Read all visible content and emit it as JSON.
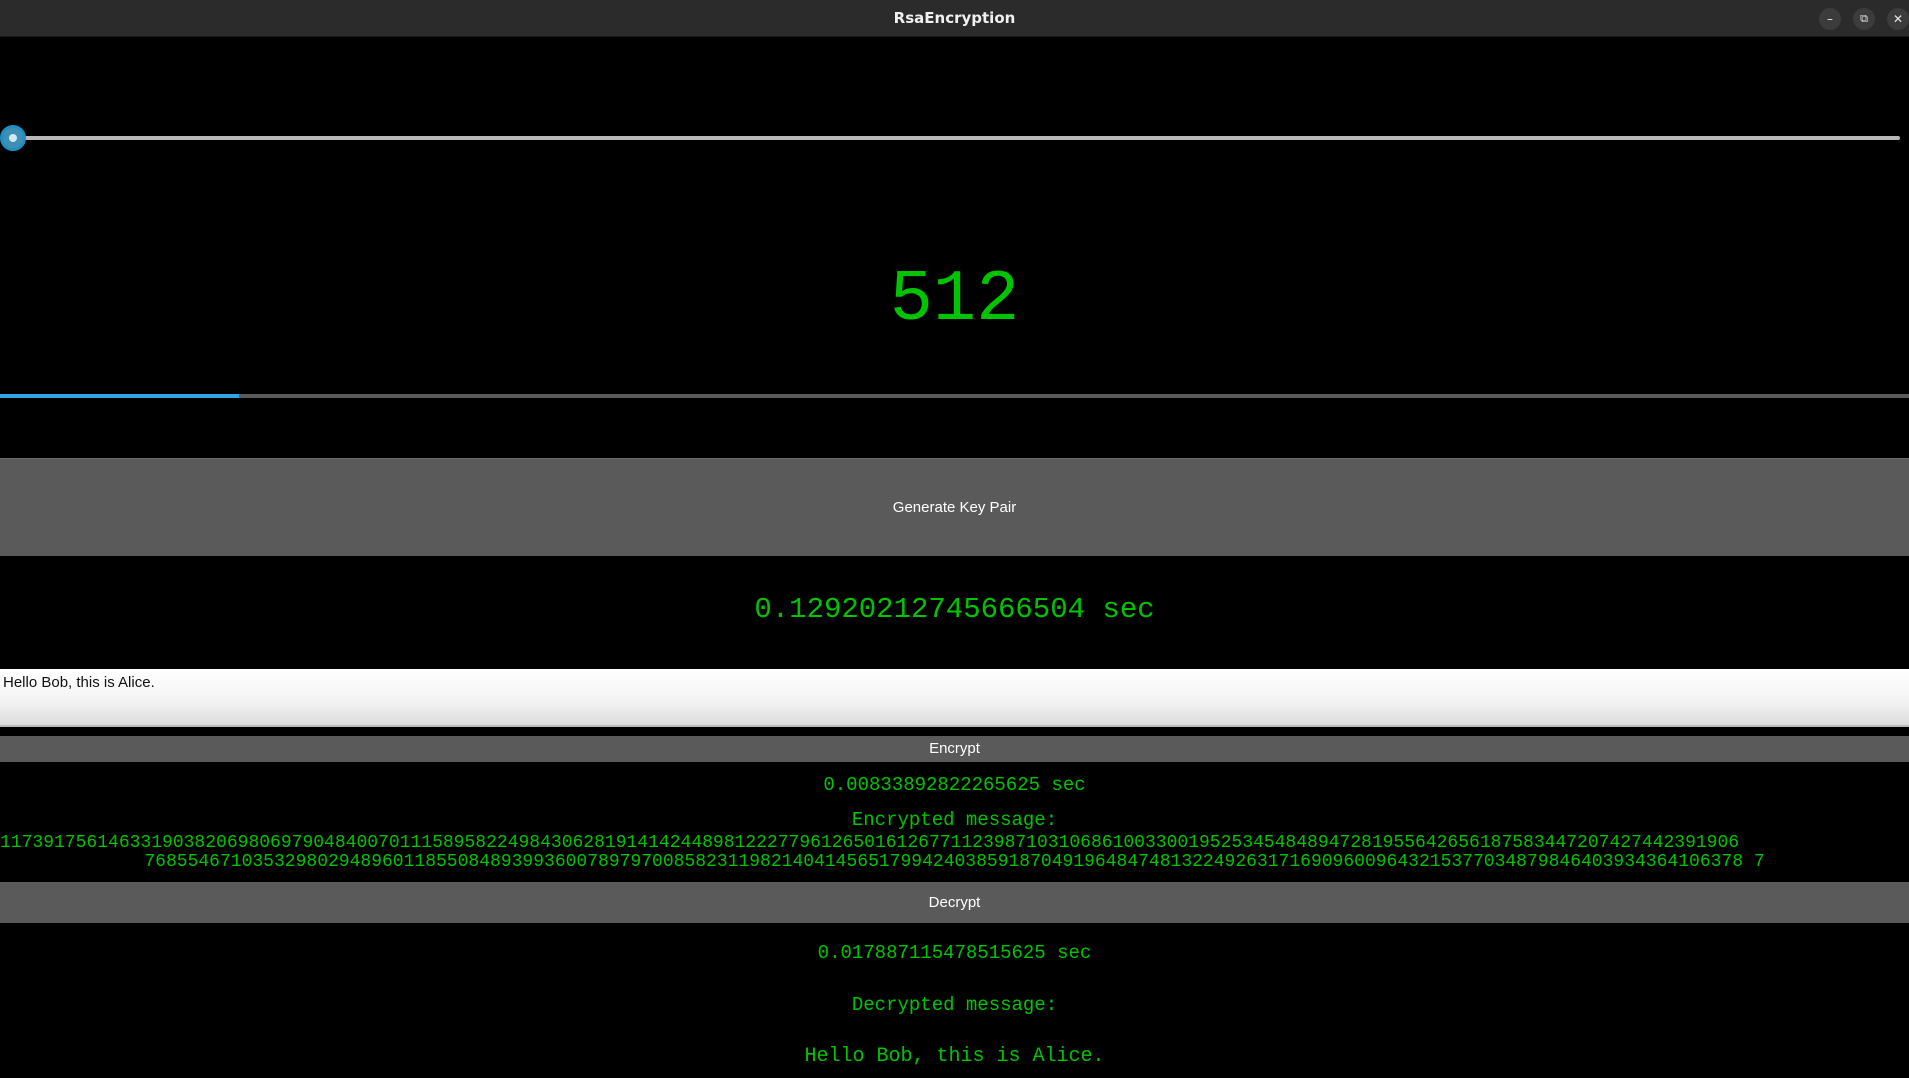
{
  "window": {
    "title": "RsaEncryption",
    "controls": {
      "minimize": "–",
      "maximize": "⧉",
      "close": "✕"
    }
  },
  "key_size": {
    "slider_value_fraction": 0.0,
    "display": "512"
  },
  "progress": {
    "fraction": 0.125,
    "accent": "#2fa7dc"
  },
  "generate": {
    "button_label": "Generate Key Pair",
    "time": "0.12920212745666504 sec"
  },
  "message_input": {
    "value": "Hello Bob, this is Alice."
  },
  "encrypt": {
    "button_label": "Encrypt",
    "time": "0.00833892822265625 sec",
    "label": "Encrypted message:",
    "ciphertext_line1": "11739175614633190382069806979048400701115895822498430628191414244898122277961265016126771123987103106861003300195253454848947281955642656187583447207427442391906",
    "ciphertext_line2": "7685546710353298029489601185508489399360078979700858231198214041456517994240385918704919648474813224926317169096009643215377034879846403934364106378 7"
  },
  "decrypt": {
    "button_label": "Decrypt",
    "time": "0.017887115478515625 sec",
    "label": "Decrypted message:",
    "message": "Hello Bob, this is Alice."
  },
  "colors": {
    "text_green": "#00c400",
    "button_gray": "#5a5a5a",
    "background": "#000000"
  }
}
